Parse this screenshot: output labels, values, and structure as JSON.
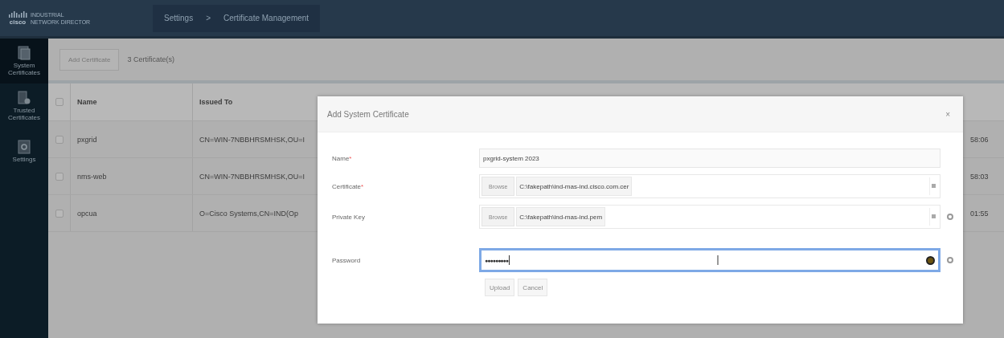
{
  "header": {
    "logo_text": "cisco",
    "product": [
      "INDUSTRIAL",
      "NETWORK DIRECTOR"
    ],
    "breadcrumb": [
      {
        "label": "Settings"
      },
      {
        "label": ">"
      },
      {
        "label": "Certificate Management"
      }
    ]
  },
  "sidebar": {
    "items": [
      {
        "label": "System Certificates",
        "selected": true
      },
      {
        "label": "Trusted Certificates",
        "selected": false
      },
      {
        "label": "Settings",
        "selected": false
      }
    ]
  },
  "toolbar": {
    "button": "Add Certificate",
    "count": "3 Certificate(s)"
  },
  "table": {
    "select_all_checked": false,
    "columns": [
      "Name",
      "Issued To"
    ],
    "rows": [
      {
        "checked": false,
        "name": "pxgrid",
        "issued_to": "CN=WIN-7NBBHRSMHSK,OU=I",
        "column_5": "58:06"
      },
      {
        "checked": false,
        "name": "nms-web",
        "issued_to": "CN=WIN-7NBBHRSMHSK,OU=I",
        "column_5": "58:03"
      },
      {
        "checked": false,
        "name": "opcua",
        "issued_to": "O=Cisco Systems,CN=IND(Op",
        "column_5": "01:55"
      }
    ]
  },
  "dialog": {
    "title": "Add System Certificate",
    "close": "×",
    "fields": [
      {
        "kind": "text",
        "label": "Name",
        "required_mark": "*",
        "value": "pxgrid-system 2023"
      },
      {
        "kind": "file",
        "label": "Certificate",
        "required_mark": "*",
        "button": "Browse",
        "value": "C:\\fakepath\\ind-mas-ind.cisco.com.cer"
      },
      {
        "kind": "file",
        "label": "Private Key",
        "button": "Browse",
        "value": "C:\\fakepath\\ind-mas-ind.pem",
        "info": true
      },
      {
        "kind": "password",
        "label": "Password",
        "value": "●●●●●●●●●",
        "info": true,
        "focused": true
      }
    ],
    "buttons": [
      "Upload",
      "Cancel"
    ]
  }
}
